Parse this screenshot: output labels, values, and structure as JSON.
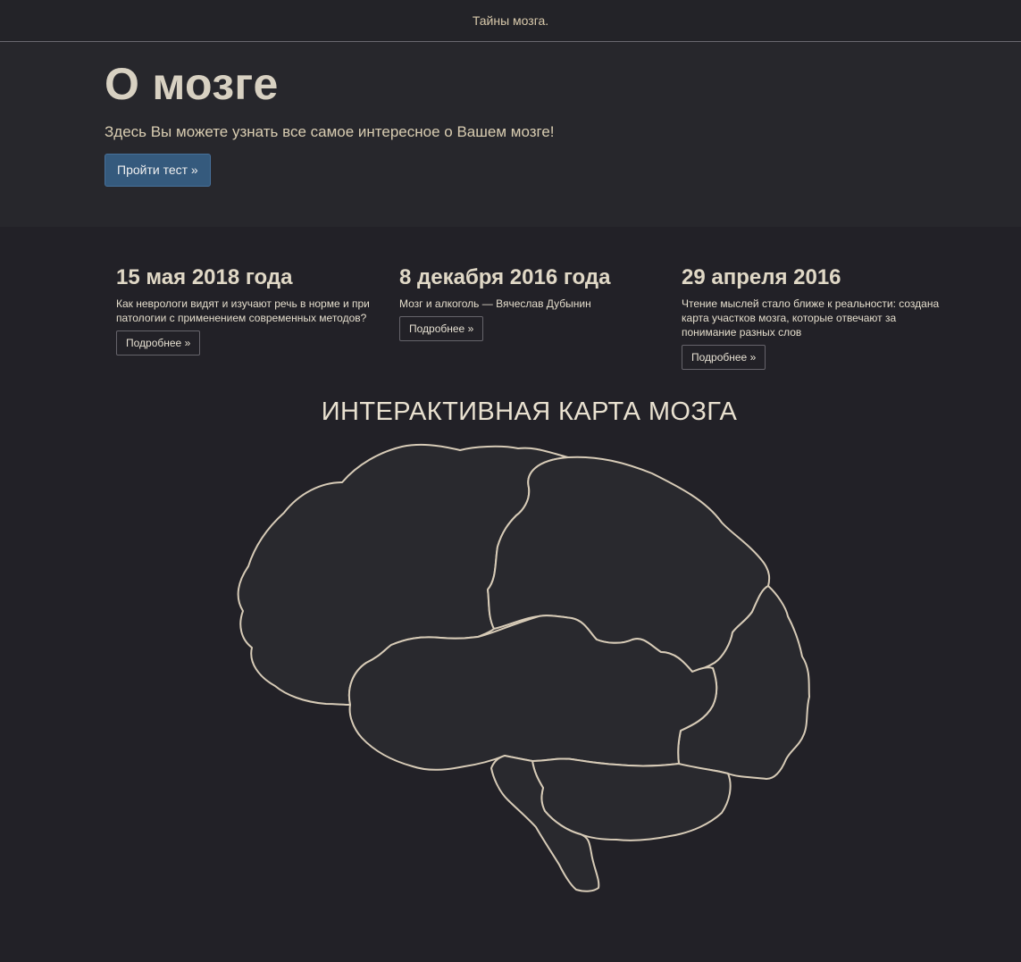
{
  "navbar": {
    "brand": "Тайны мозга."
  },
  "hero": {
    "title": "О мозге",
    "lead": "Здесь Вы можете узнать все самое интересное о Вашем мозге!",
    "button": "Пройти тест »"
  },
  "news": [
    {
      "date": "15 мая 2018 года",
      "text": "Как неврологи видят и изучают речь в норме и при патологии с применением современных методов?",
      "button": "Подробнее »"
    },
    {
      "date": "8 декабря 2016 года",
      "text": "Мозг и алкоголь — Вячеслав Дубынин",
      "button": "Подробнее »"
    },
    {
      "date": "29 апреля 2016",
      "text": "Чтение мыслей стало ближе к реальности: создана карта участков мозга, которые отвечают за понимание разных слов",
      "button": "Подробнее »"
    }
  ],
  "map": {
    "title": "ИНТЕРАКТИВНАЯ КАРТА МОЗГА"
  },
  "colors": {
    "background": "#222127",
    "hero_background": "#27272c",
    "primary_button": "#355a7d",
    "text": "#e2d9c6",
    "outline": "#d7cbb7"
  }
}
